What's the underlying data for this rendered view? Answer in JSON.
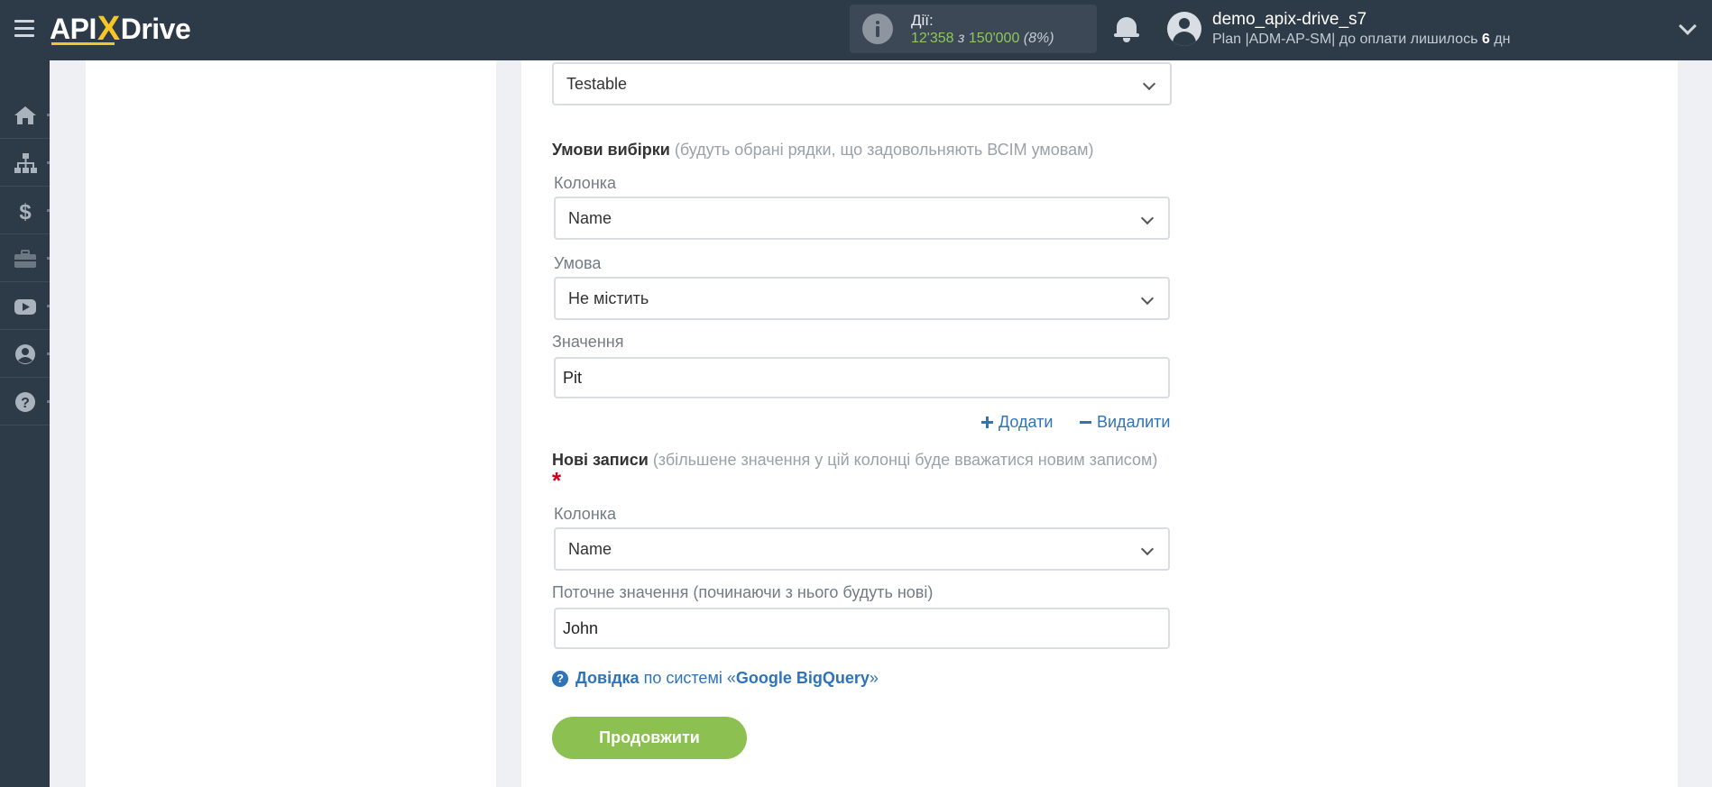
{
  "header": {
    "logo": {
      "part1": "API",
      "part2": "X",
      "part3": "Drive"
    },
    "actions": {
      "label": "Дії:",
      "used": "12'358",
      "separator": "з",
      "total": "150'000",
      "percent": "(8%)"
    },
    "user": {
      "name": "demo_apix-drive_s7",
      "plan_prefix": "Plan |ADM-AP-SM| до оплати лишилось",
      "days": "6",
      "days_suffix": "дн"
    }
  },
  "sidebar": {
    "items": [
      {
        "name": "home-icon"
      },
      {
        "name": "sitemap-icon"
      },
      {
        "name": "dollar-icon"
      },
      {
        "name": "briefcase-icon"
      },
      {
        "name": "youtube-icon"
      },
      {
        "name": "user-circle-icon"
      },
      {
        "name": "question-icon"
      }
    ]
  },
  "form": {
    "table_select": {
      "value": "Testable"
    },
    "conditions": {
      "title": "Умови вибірки",
      "hint": "(будуть обрані рядки, що задовольняють ВСІМ умовам)",
      "column_label": "Колонка",
      "column_value": "Name",
      "condition_label": "Умова",
      "condition_value": "Не містить",
      "value_label": "Значення",
      "value_value": "Pit",
      "add_label": "Додати",
      "remove_label": "Видалити"
    },
    "new_records": {
      "title": "Нові записи",
      "hint": "(збільшене значення у цій колонці буде вважатися новим записом)",
      "required_mark": "*",
      "column_label": "Колонка",
      "column_value": "Name",
      "current_label": "Поточне значення (починаючи з нього будуть нові)",
      "current_value": "John"
    },
    "help": {
      "prefix": "Довідка",
      "middle": "по системі «",
      "system": "Google BigQuery",
      "suffix": "»"
    },
    "continue_label": "Продовжити"
  },
  "colors": {
    "topbar": "#2d3a48",
    "accent_green": "#8cc152",
    "link_blue": "#2f73b8",
    "logo_yellow": "#f7c524"
  }
}
